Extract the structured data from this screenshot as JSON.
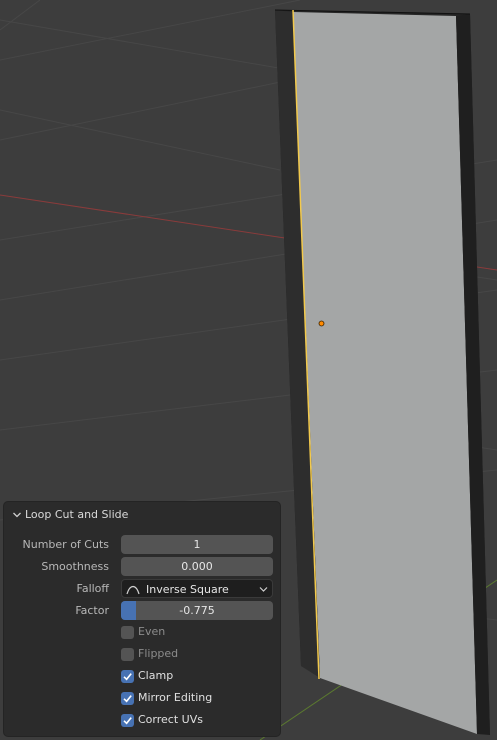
{
  "panel": {
    "title": "Loop Cut and Slide",
    "rows": {
      "number_of_cuts": {
        "label": "Number of Cuts",
        "value": "1"
      },
      "smoothness": {
        "label": "Smoothness",
        "value": "0.000"
      },
      "falloff": {
        "label": "Falloff",
        "value": "Inverse Square"
      },
      "factor": {
        "label": "Factor",
        "value": "-0.775"
      }
    },
    "checkboxes": [
      {
        "label": "Even",
        "checked": false
      },
      {
        "label": "Flipped",
        "checked": false
      },
      {
        "label": "Clamp",
        "checked": true
      },
      {
        "label": "Mirror Editing",
        "checked": true
      },
      {
        "label": "Correct UVs",
        "checked": true
      }
    ]
  },
  "colors": {
    "viewport_bg": "#3d3d3d",
    "panel_bg": "#2b2b2b",
    "accent": "#4772b3",
    "selected_edge": "#f2c94c",
    "origin_dot": "#ff8a00"
  }
}
